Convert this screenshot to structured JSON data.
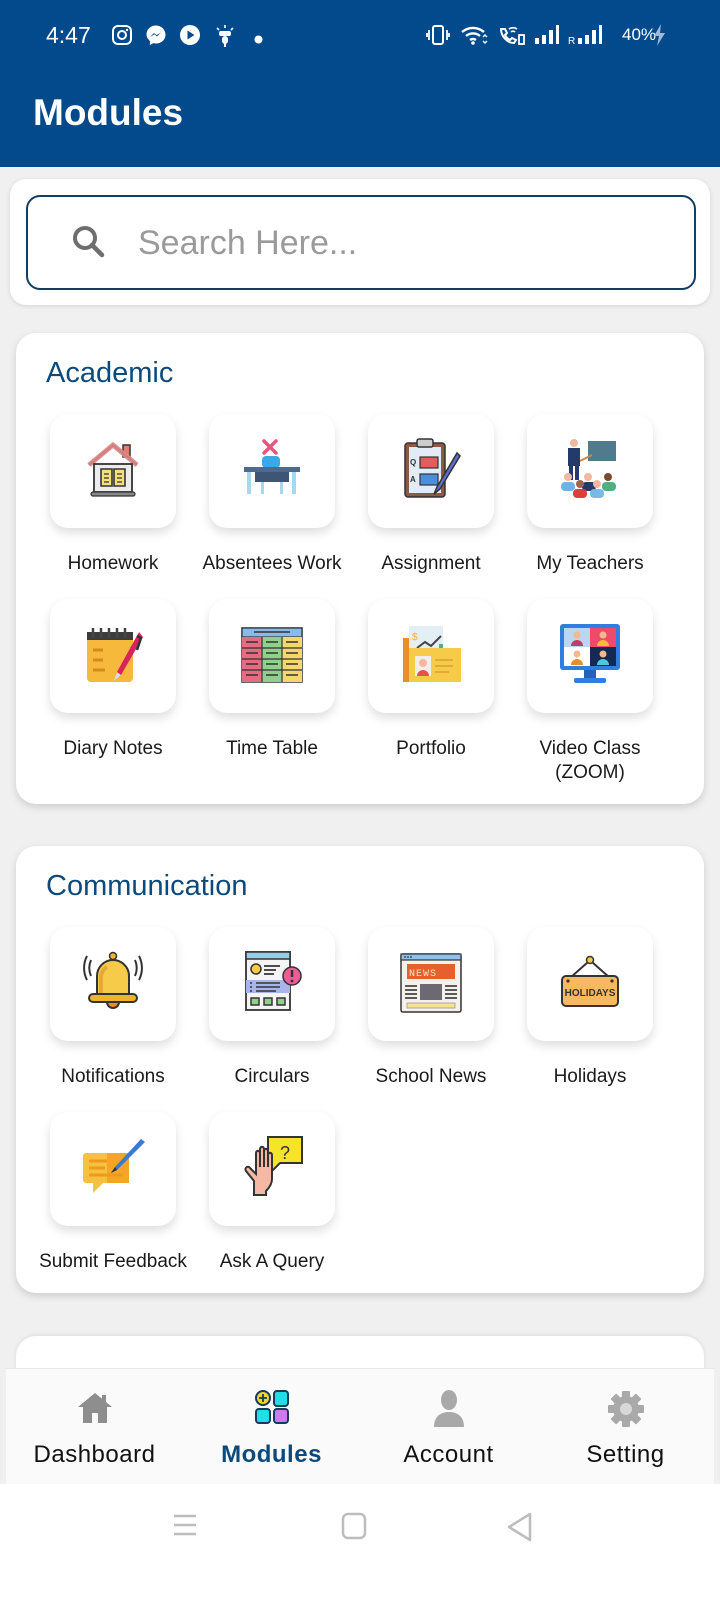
{
  "status_bar": {
    "time": "4:47",
    "left_icons": [
      "instagram-icon",
      "messenger-icon",
      "play-icon",
      "scooter-app-icon",
      "dot-icon"
    ],
    "right_icons": [
      "vibrate-icon",
      "wifi-icon",
      "wifi-calling-icon",
      "signal-icon",
      "signal-roaming-icon"
    ],
    "battery": "40%",
    "charging": true
  },
  "header": {
    "title": "Modules",
    "color": "#024a8c"
  },
  "search": {
    "placeholder": "Search Here...",
    "value": ""
  },
  "sections": [
    {
      "title": "Academic",
      "items": [
        {
          "label": "Homework",
          "icon": "house-book-icon"
        },
        {
          "label": "Absentees Work",
          "icon": "empty-desk-icon"
        },
        {
          "label": "Assignment",
          "icon": "clipboard-qa-icon"
        },
        {
          "label": "My Teachers",
          "icon": "teacher-class-icon"
        },
        {
          "label": "Diary Notes",
          "icon": "notepad-pen-icon"
        },
        {
          "label": "Time Table",
          "icon": "timetable-icon"
        },
        {
          "label": "Portfolio",
          "icon": "portfolio-folder-icon"
        },
        {
          "label": "Video Class\n(ZOOM)",
          "label_line1": "Video Class",
          "label_line2": "(ZOOM)",
          "icon": "video-conference-icon"
        }
      ]
    },
    {
      "title": "Communication",
      "items": [
        {
          "label": "Notifications",
          "icon": "bell-icon"
        },
        {
          "label": "Circulars",
          "icon": "circular-alert-icon"
        },
        {
          "label": "School News",
          "icon": "newspaper-icon"
        },
        {
          "label": "Holidays",
          "icon": "holidays-sign-icon",
          "icon_text": "HOLIDAYS"
        },
        {
          "label": "Submit Feedback",
          "icon": "feedback-pen-icon"
        },
        {
          "label": "Ask A Query",
          "icon": "raised-hand-question-icon"
        }
      ]
    }
  ],
  "bottom_nav": {
    "items": [
      {
        "label": "Dashboard",
        "icon": "home-icon",
        "active": false
      },
      {
        "label": "Modules",
        "icon": "modules-grid-icon",
        "active": true
      },
      {
        "label": "Account",
        "icon": "user-icon",
        "active": false
      },
      {
        "label": "Setting",
        "icon": "gear-icon",
        "active": false
      }
    ],
    "active_color": "#0c4a7c"
  },
  "system_nav": [
    "menu-button",
    "home-button",
    "back-button"
  ]
}
